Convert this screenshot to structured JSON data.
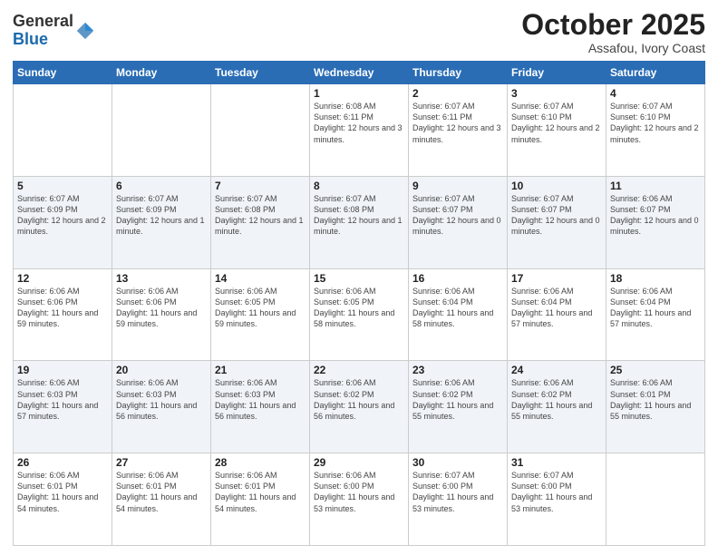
{
  "logo": {
    "general": "General",
    "blue": "Blue"
  },
  "header": {
    "month": "October 2025",
    "location": "Assafou, Ivory Coast"
  },
  "days_of_week": [
    "Sunday",
    "Monday",
    "Tuesday",
    "Wednesday",
    "Thursday",
    "Friday",
    "Saturday"
  ],
  "weeks": [
    [
      {
        "day": "",
        "info": ""
      },
      {
        "day": "",
        "info": ""
      },
      {
        "day": "",
        "info": ""
      },
      {
        "day": "1",
        "info": "Sunrise: 6:08 AM\nSunset: 6:11 PM\nDaylight: 12 hours\nand 3 minutes."
      },
      {
        "day": "2",
        "info": "Sunrise: 6:07 AM\nSunset: 6:11 PM\nDaylight: 12 hours\nand 3 minutes."
      },
      {
        "day": "3",
        "info": "Sunrise: 6:07 AM\nSunset: 6:10 PM\nDaylight: 12 hours\nand 2 minutes."
      },
      {
        "day": "4",
        "info": "Sunrise: 6:07 AM\nSunset: 6:10 PM\nDaylight: 12 hours\nand 2 minutes."
      }
    ],
    [
      {
        "day": "5",
        "info": "Sunrise: 6:07 AM\nSunset: 6:09 PM\nDaylight: 12 hours\nand 2 minutes."
      },
      {
        "day": "6",
        "info": "Sunrise: 6:07 AM\nSunset: 6:09 PM\nDaylight: 12 hours\nand 1 minute."
      },
      {
        "day": "7",
        "info": "Sunrise: 6:07 AM\nSunset: 6:08 PM\nDaylight: 12 hours\nand 1 minute."
      },
      {
        "day": "8",
        "info": "Sunrise: 6:07 AM\nSunset: 6:08 PM\nDaylight: 12 hours\nand 1 minute."
      },
      {
        "day": "9",
        "info": "Sunrise: 6:07 AM\nSunset: 6:07 PM\nDaylight: 12 hours\nand 0 minutes."
      },
      {
        "day": "10",
        "info": "Sunrise: 6:07 AM\nSunset: 6:07 PM\nDaylight: 12 hours\nand 0 minutes."
      },
      {
        "day": "11",
        "info": "Sunrise: 6:06 AM\nSunset: 6:07 PM\nDaylight: 12 hours\nand 0 minutes."
      }
    ],
    [
      {
        "day": "12",
        "info": "Sunrise: 6:06 AM\nSunset: 6:06 PM\nDaylight: 11 hours\nand 59 minutes."
      },
      {
        "day": "13",
        "info": "Sunrise: 6:06 AM\nSunset: 6:06 PM\nDaylight: 11 hours\nand 59 minutes."
      },
      {
        "day": "14",
        "info": "Sunrise: 6:06 AM\nSunset: 6:05 PM\nDaylight: 11 hours\nand 59 minutes."
      },
      {
        "day": "15",
        "info": "Sunrise: 6:06 AM\nSunset: 6:05 PM\nDaylight: 11 hours\nand 58 minutes."
      },
      {
        "day": "16",
        "info": "Sunrise: 6:06 AM\nSunset: 6:04 PM\nDaylight: 11 hours\nand 58 minutes."
      },
      {
        "day": "17",
        "info": "Sunrise: 6:06 AM\nSunset: 6:04 PM\nDaylight: 11 hours\nand 57 minutes."
      },
      {
        "day": "18",
        "info": "Sunrise: 6:06 AM\nSunset: 6:04 PM\nDaylight: 11 hours\nand 57 minutes."
      }
    ],
    [
      {
        "day": "19",
        "info": "Sunrise: 6:06 AM\nSunset: 6:03 PM\nDaylight: 11 hours\nand 57 minutes."
      },
      {
        "day": "20",
        "info": "Sunrise: 6:06 AM\nSunset: 6:03 PM\nDaylight: 11 hours\nand 56 minutes."
      },
      {
        "day": "21",
        "info": "Sunrise: 6:06 AM\nSunset: 6:03 PM\nDaylight: 11 hours\nand 56 minutes."
      },
      {
        "day": "22",
        "info": "Sunrise: 6:06 AM\nSunset: 6:02 PM\nDaylight: 11 hours\nand 56 minutes."
      },
      {
        "day": "23",
        "info": "Sunrise: 6:06 AM\nSunset: 6:02 PM\nDaylight: 11 hours\nand 55 minutes."
      },
      {
        "day": "24",
        "info": "Sunrise: 6:06 AM\nSunset: 6:02 PM\nDaylight: 11 hours\nand 55 minutes."
      },
      {
        "day": "25",
        "info": "Sunrise: 6:06 AM\nSunset: 6:01 PM\nDaylight: 11 hours\nand 55 minutes."
      }
    ],
    [
      {
        "day": "26",
        "info": "Sunrise: 6:06 AM\nSunset: 6:01 PM\nDaylight: 11 hours\nand 54 minutes."
      },
      {
        "day": "27",
        "info": "Sunrise: 6:06 AM\nSunset: 6:01 PM\nDaylight: 11 hours\nand 54 minutes."
      },
      {
        "day": "28",
        "info": "Sunrise: 6:06 AM\nSunset: 6:01 PM\nDaylight: 11 hours\nand 54 minutes."
      },
      {
        "day": "29",
        "info": "Sunrise: 6:06 AM\nSunset: 6:00 PM\nDaylight: 11 hours\nand 53 minutes."
      },
      {
        "day": "30",
        "info": "Sunrise: 6:07 AM\nSunset: 6:00 PM\nDaylight: 11 hours\nand 53 minutes."
      },
      {
        "day": "31",
        "info": "Sunrise: 6:07 AM\nSunset: 6:00 PM\nDaylight: 11 hours\nand 53 minutes."
      },
      {
        "day": "",
        "info": ""
      }
    ]
  ]
}
